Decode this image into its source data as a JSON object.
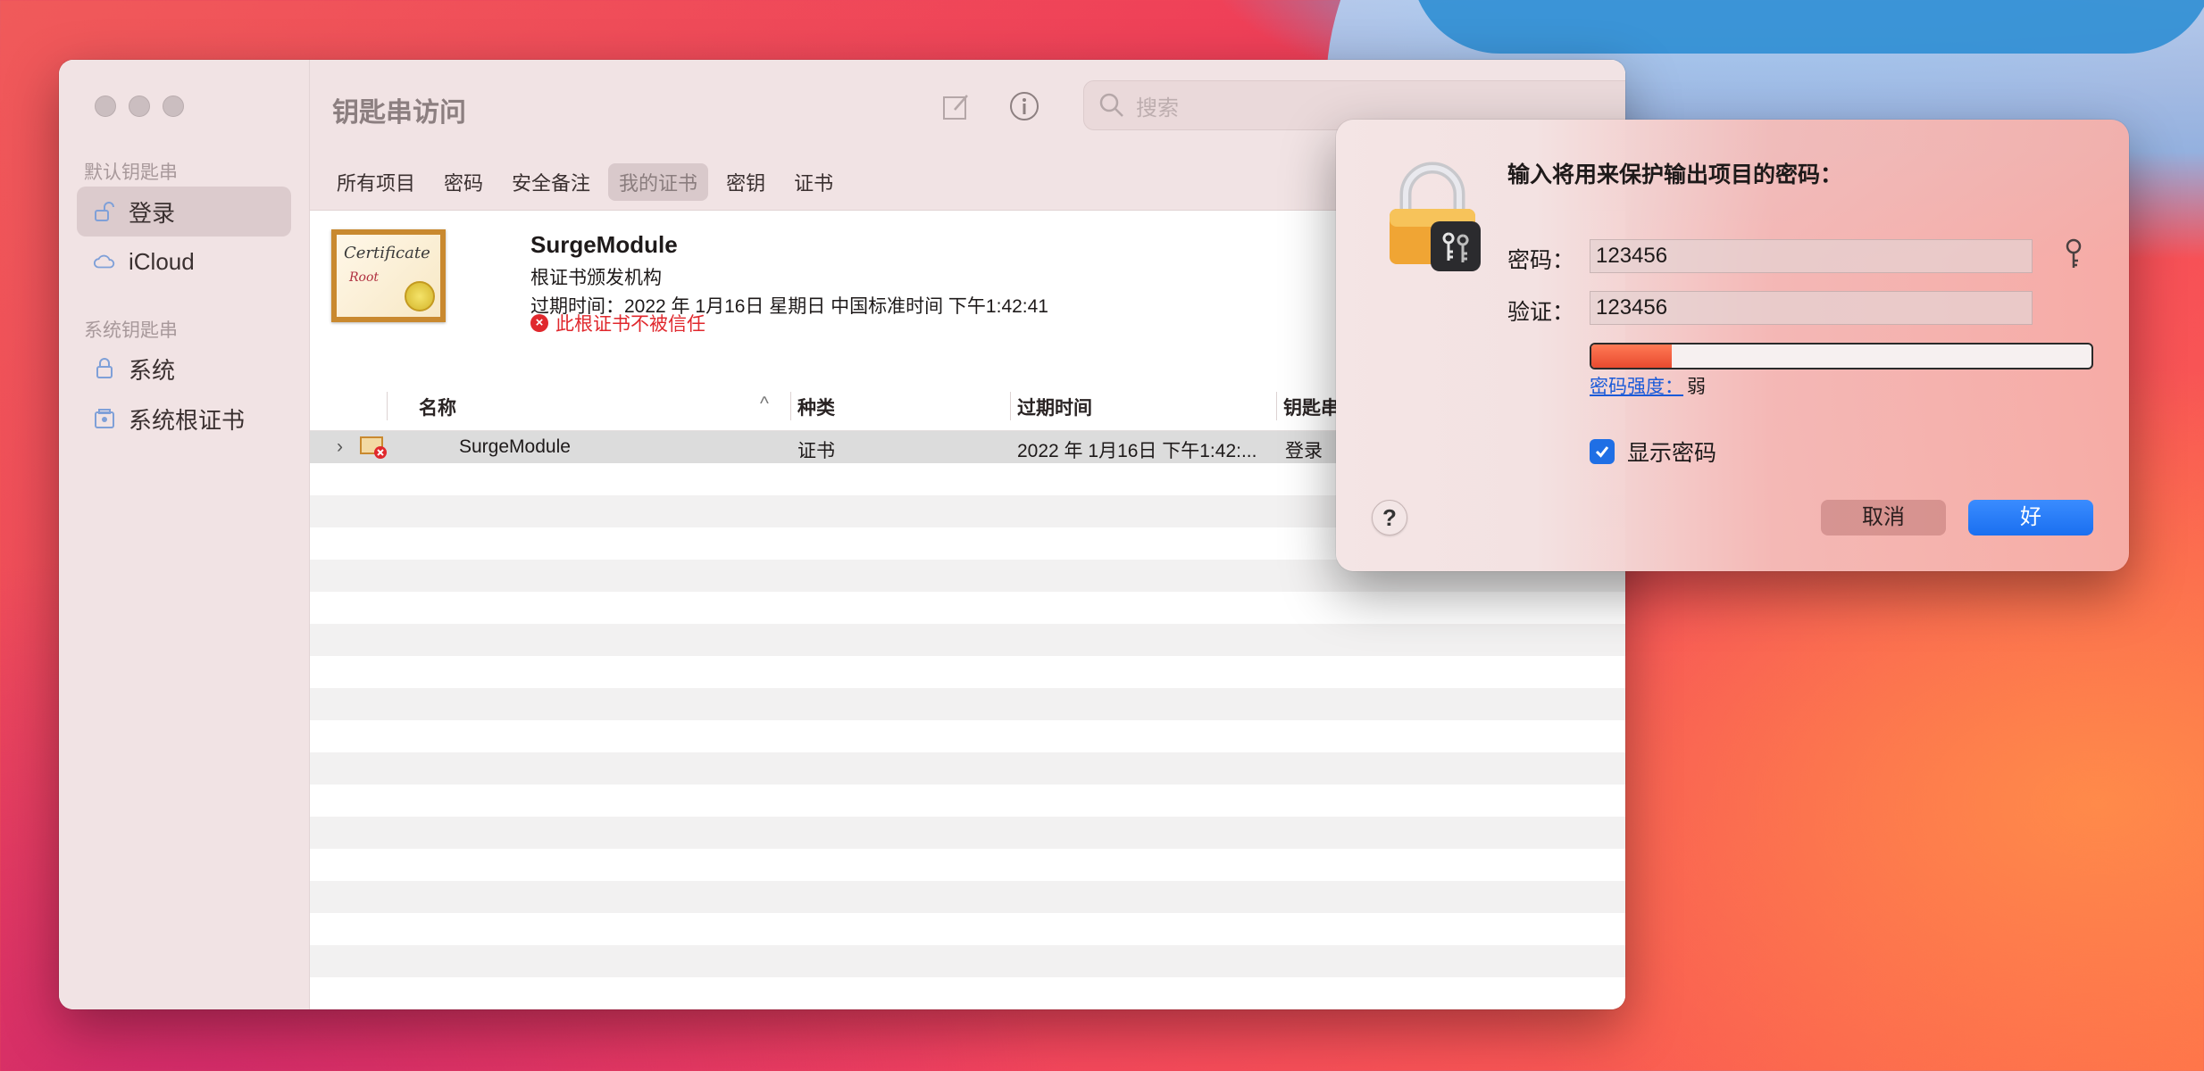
{
  "window": {
    "title": "钥匙串访问",
    "search_placeholder": "搜索"
  },
  "sidebar": {
    "default_section": "默认钥匙串",
    "system_section": "系统钥匙串",
    "items": [
      {
        "label": "登录",
        "active": true
      },
      {
        "label": "iCloud",
        "active": false
      },
      {
        "label": "系统",
        "active": false
      },
      {
        "label": "系统根证书",
        "active": false
      }
    ]
  },
  "tabs": [
    {
      "label": "所有项目"
    },
    {
      "label": "密码"
    },
    {
      "label": "安全备注"
    },
    {
      "label": "我的证书",
      "active": true
    },
    {
      "label": "密钥"
    },
    {
      "label": "证书"
    }
  ],
  "certificate": {
    "image_text_1": "Certificate",
    "image_text_2": "Root",
    "name": "SurgeModule",
    "issuer": "根证书颁发机构",
    "expiry": "过期时间：2022 年 1月16日 星期日 中国标准时间 下午1:42:41",
    "warning": "此根证书不被信任"
  },
  "table": {
    "columns": [
      "名称",
      "种类",
      "过期时间",
      "钥匙串"
    ],
    "rows": [
      {
        "name": "SurgeModule",
        "kind": "证书",
        "expires": "2022 年 1月16日 下午1:42:...",
        "keychain": "登录"
      }
    ]
  },
  "dialog": {
    "title": "输入将用来保护输出项目的密码：",
    "password_label": "密码：",
    "password_value": "123456",
    "verify_label": "验证：",
    "verify_value": "123456",
    "strength_label": "密码强度：",
    "strength_value": "弱",
    "strength_fraction": 0.16,
    "show_password_label": "显示密码",
    "show_password_checked": true,
    "help_label": "?",
    "cancel_label": "取消",
    "ok_label": "好"
  },
  "colors": {
    "accent": "#1f6fe5",
    "warning": "#e0282d",
    "strength_bar": "#ff6a45"
  }
}
